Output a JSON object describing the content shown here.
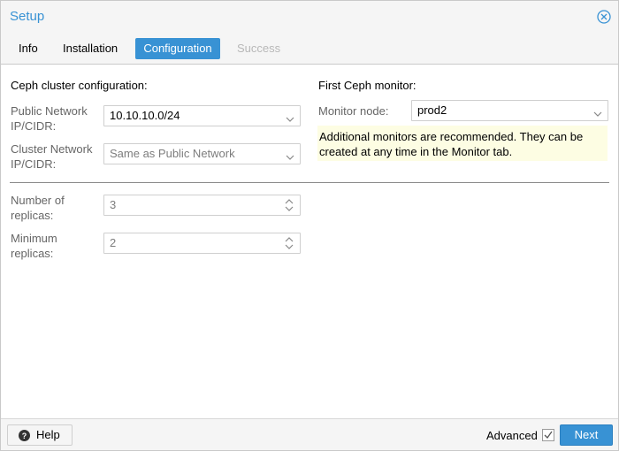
{
  "window": {
    "title": "Setup"
  },
  "tabs": [
    {
      "label": "Info"
    },
    {
      "label": "Installation"
    },
    {
      "label": "Configuration"
    },
    {
      "label": "Success"
    }
  ],
  "cluster": {
    "heading": "Ceph cluster configuration:",
    "public_network": {
      "label": "Public Network IP/CIDR:",
      "value": "10.10.10.0/24"
    },
    "cluster_network": {
      "label": "Cluster Network IP/CIDR:",
      "placeholder": "Same as Public Network"
    },
    "replicas": {
      "label": "Number of replicas:",
      "value": "3"
    },
    "min_replicas": {
      "label": "Minimum replicas:",
      "value": "2"
    }
  },
  "monitor": {
    "heading": "First Ceph monitor:",
    "node_label": "Monitor node:",
    "node_value": "prod2",
    "note": "Additional monitors are recommended. They can be created at any time in the Monitor tab."
  },
  "footer": {
    "help_label": "Help",
    "advanced_label": "Advanced",
    "advanced_checked": true,
    "next_label": "Next"
  },
  "colors": {
    "accent": "#3892d4",
    "note_background": "#fdfde3"
  }
}
